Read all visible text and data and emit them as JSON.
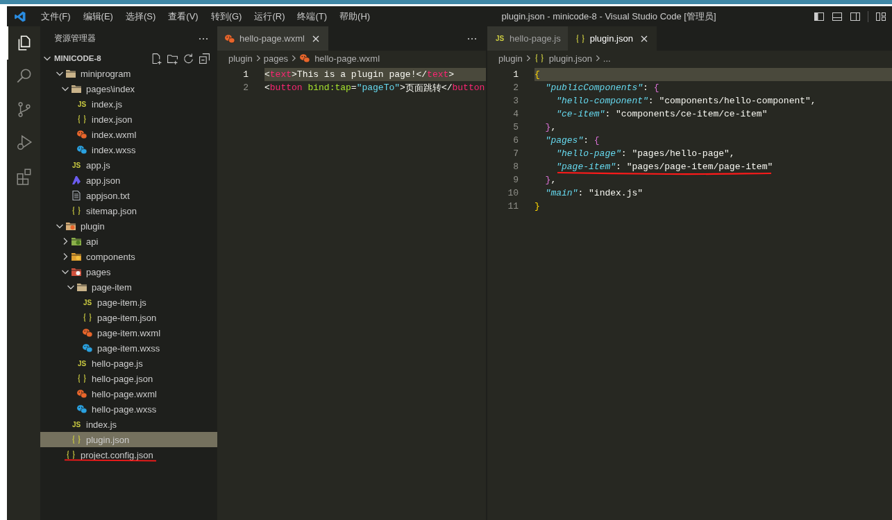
{
  "window": {
    "title": "plugin.json - minicode-8 - Visual Studio Code [管理员]"
  },
  "menu": [
    "文件(F)",
    "编辑(E)",
    "选择(S)",
    "查看(V)",
    "转到(G)",
    "运行(R)",
    "终端(T)",
    "帮助(H)"
  ],
  "activity_bar": [
    {
      "kind": "explorer",
      "selected": true
    },
    {
      "kind": "search",
      "selected": false
    },
    {
      "kind": "source-control",
      "selected": false
    },
    {
      "kind": "run-debug",
      "selected": false
    },
    {
      "kind": "extensions",
      "selected": false
    }
  ],
  "sidebar": {
    "title": "资源管理器",
    "section": {
      "title": "MINICODE-8",
      "expanded": true
    },
    "tree": [
      {
        "label": "miniprogram",
        "kind": "folder",
        "expanded": true,
        "selected": false,
        "marked": false,
        "children": [
          {
            "label": "pages\\index",
            "kind": "folder",
            "expanded": true,
            "selected": false,
            "children": [
              {
                "label": "index.js",
                "kind": "js",
                "icon_text": "JS",
                "selected": false
              },
              {
                "label": "index.json",
                "kind": "json",
                "selected": false
              },
              {
                "label": "index.wxml",
                "kind": "wxml",
                "selected": false
              },
              {
                "label": "index.wxss",
                "kind": "wxss",
                "selected": false
              }
            ]
          },
          {
            "label": "app.js",
            "kind": "js",
            "icon_text": "JS",
            "selected": false
          },
          {
            "label": "app.json",
            "kind": "app",
            "selected": false
          },
          {
            "label": "appjson.txt",
            "kind": "txt",
            "selected": false
          },
          {
            "label": "sitemap.json",
            "kind": "json",
            "selected": false
          }
        ]
      },
      {
        "label": "plugin",
        "kind": "folder-plugin",
        "expanded": true,
        "selected": false,
        "marked": false,
        "children": [
          {
            "label": "api",
            "kind": "folder-api",
            "expanded": false,
            "selected": false
          },
          {
            "label": "components",
            "kind": "folder-components",
            "expanded": false,
            "selected": false
          },
          {
            "label": "pages",
            "kind": "folder-pages",
            "expanded": true,
            "selected": false,
            "children": [
              {
                "label": "page-item",
                "kind": "folder",
                "expanded": true,
                "selected": false,
                "children": [
                  {
                    "label": "page-item.js",
                    "kind": "js",
                    "icon_text": "JS",
                    "selected": false
                  },
                  {
                    "label": "page-item.json",
                    "kind": "json",
                    "selected": false
                  },
                  {
                    "label": "page-item.wxml",
                    "kind": "wxml",
                    "selected": false
                  },
                  {
                    "label": "page-item.wxss",
                    "kind": "wxss",
                    "selected": false
                  }
                ]
              },
              {
                "label": "hello-page.js",
                "kind": "js",
                "icon_text": "JS",
                "selected": false
              },
              {
                "label": "hello-page.json",
                "kind": "json",
                "selected": false
              },
              {
                "label": "hello-page.wxml",
                "kind": "wxml",
                "selected": false
              },
              {
                "label": "hello-page.wxss",
                "kind": "wxss",
                "selected": false
              }
            ]
          },
          {
            "label": "index.js",
            "kind": "js",
            "icon_text": "JS",
            "selected": false
          },
          {
            "label": "plugin.json",
            "kind": "json",
            "selected": true
          }
        ]
      },
      {
        "label": "project.config.json",
        "kind": "json",
        "selected": false,
        "marked": true
      }
    ]
  },
  "editor_groups": [
    {
      "tabs": [
        {
          "label": "hello-page.wxml",
          "kind": "wxml",
          "selected": true
        }
      ],
      "breadcrumbs": [
        {
          "label": "plugin"
        },
        {
          "label": "pages"
        },
        {
          "label": "hello-page.wxml",
          "kind": "wxml"
        }
      ],
      "lines": [
        {
          "number": "1",
          "highlighted": true,
          "underlined": false,
          "tokens": [
            {
              "kind": "punct",
              "text": "<"
            },
            {
              "kind": "tag",
              "text": "text"
            },
            {
              "kind": "punct",
              "text": ">"
            },
            {
              "kind": "plain",
              "text": "This is a plugin page!"
            },
            {
              "kind": "punct",
              "text": "</"
            },
            {
              "kind": "tag",
              "text": "text"
            },
            {
              "kind": "punct",
              "text": ">"
            }
          ]
        },
        {
          "number": "2",
          "highlighted": false,
          "underlined": false,
          "tokens": [
            {
              "kind": "punct",
              "text": "<"
            },
            {
              "kind": "tag",
              "text": "button"
            },
            {
              "kind": "attr",
              "text": " bind:tap"
            },
            {
              "kind": "punct",
              "text": "="
            },
            {
              "kind": "value",
              "text": "\"pageTo\""
            },
            {
              "kind": "punct",
              "text": ">"
            },
            {
              "kind": "plain",
              "text": "页面跳转"
            },
            {
              "kind": "punct",
              "text": "</"
            },
            {
              "kind": "tag",
              "text": "button"
            }
          ]
        }
      ]
    },
    {
      "tabs": [
        {
          "label": "hello-page.js",
          "kind": "js",
          "icon_text": "JS",
          "selected": false
        },
        {
          "label": "plugin.json",
          "kind": "json",
          "selected": true
        }
      ],
      "breadcrumbs": [
        {
          "label": "plugin"
        },
        {
          "label": "plugin.json",
          "kind": "json"
        },
        {
          "label": "..."
        }
      ],
      "lines": [
        {
          "number": "1",
          "highlighted": true,
          "underlined": false,
          "tokens": [
            {
              "kind": "brace1",
              "text": "{"
            }
          ]
        },
        {
          "number": "2",
          "highlighted": false,
          "underlined": false,
          "tokens": [
            {
              "kind": "key",
              "text": "  \"publicComponents\""
            },
            {
              "kind": "punct",
              "text": ": "
            },
            {
              "kind": "brace2",
              "text": "{"
            }
          ]
        },
        {
          "number": "3",
          "highlighted": false,
          "underlined": false,
          "tokens": [
            {
              "kind": "key",
              "text": "    \"hello-component\""
            },
            {
              "kind": "punct",
              "text": ": "
            },
            {
              "kind": "string",
              "text": "\"components/hello-component\","
            }
          ]
        },
        {
          "number": "4",
          "highlighted": false,
          "underlined": false,
          "tokens": [
            {
              "kind": "key",
              "text": "    \"ce-item\""
            },
            {
              "kind": "punct",
              "text": ": "
            },
            {
              "kind": "string",
              "text": "\"components/ce-item/ce-item\""
            }
          ]
        },
        {
          "number": "5",
          "highlighted": false,
          "underlined": false,
          "tokens": [
            {
              "kind": "brace2",
              "text": "  }"
            },
            {
              "kind": "punct",
              "text": ","
            }
          ]
        },
        {
          "number": "6",
          "highlighted": false,
          "underlined": false,
          "tokens": [
            {
              "kind": "key",
              "text": "  \"pages\""
            },
            {
              "kind": "punct",
              "text": ": "
            },
            {
              "kind": "brace2",
              "text": "{"
            }
          ]
        },
        {
          "number": "7",
          "highlighted": false,
          "underlined": false,
          "tokens": [
            {
              "kind": "key",
              "text": "    \"hello-page\""
            },
            {
              "kind": "punct",
              "text": ": "
            },
            {
              "kind": "string",
              "text": "\"pages/hello-page\","
            }
          ]
        },
        {
          "number": "8",
          "highlighted": false,
          "underlined": true,
          "tokens": [
            {
              "kind": "key",
              "text": "    \"page-item\""
            },
            {
              "kind": "punct",
              "text": ": "
            },
            {
              "kind": "string",
              "text": "\"pages/page-item/page-item\""
            }
          ]
        },
        {
          "number": "9",
          "highlighted": false,
          "underlined": false,
          "tokens": [
            {
              "kind": "brace2",
              "text": "  }"
            },
            {
              "kind": "punct",
              "text": ","
            }
          ]
        },
        {
          "number": "10",
          "highlighted": false,
          "underlined": false,
          "tokens": [
            {
              "kind": "key",
              "text": "  \"main\""
            },
            {
              "kind": "punct",
              "text": ": "
            },
            {
              "kind": "string",
              "text": "\"index.js\""
            }
          ]
        },
        {
          "number": "11",
          "highlighted": false,
          "underlined": false,
          "tokens": [
            {
              "kind": "brace1",
              "text": "}"
            }
          ]
        }
      ]
    }
  ]
}
